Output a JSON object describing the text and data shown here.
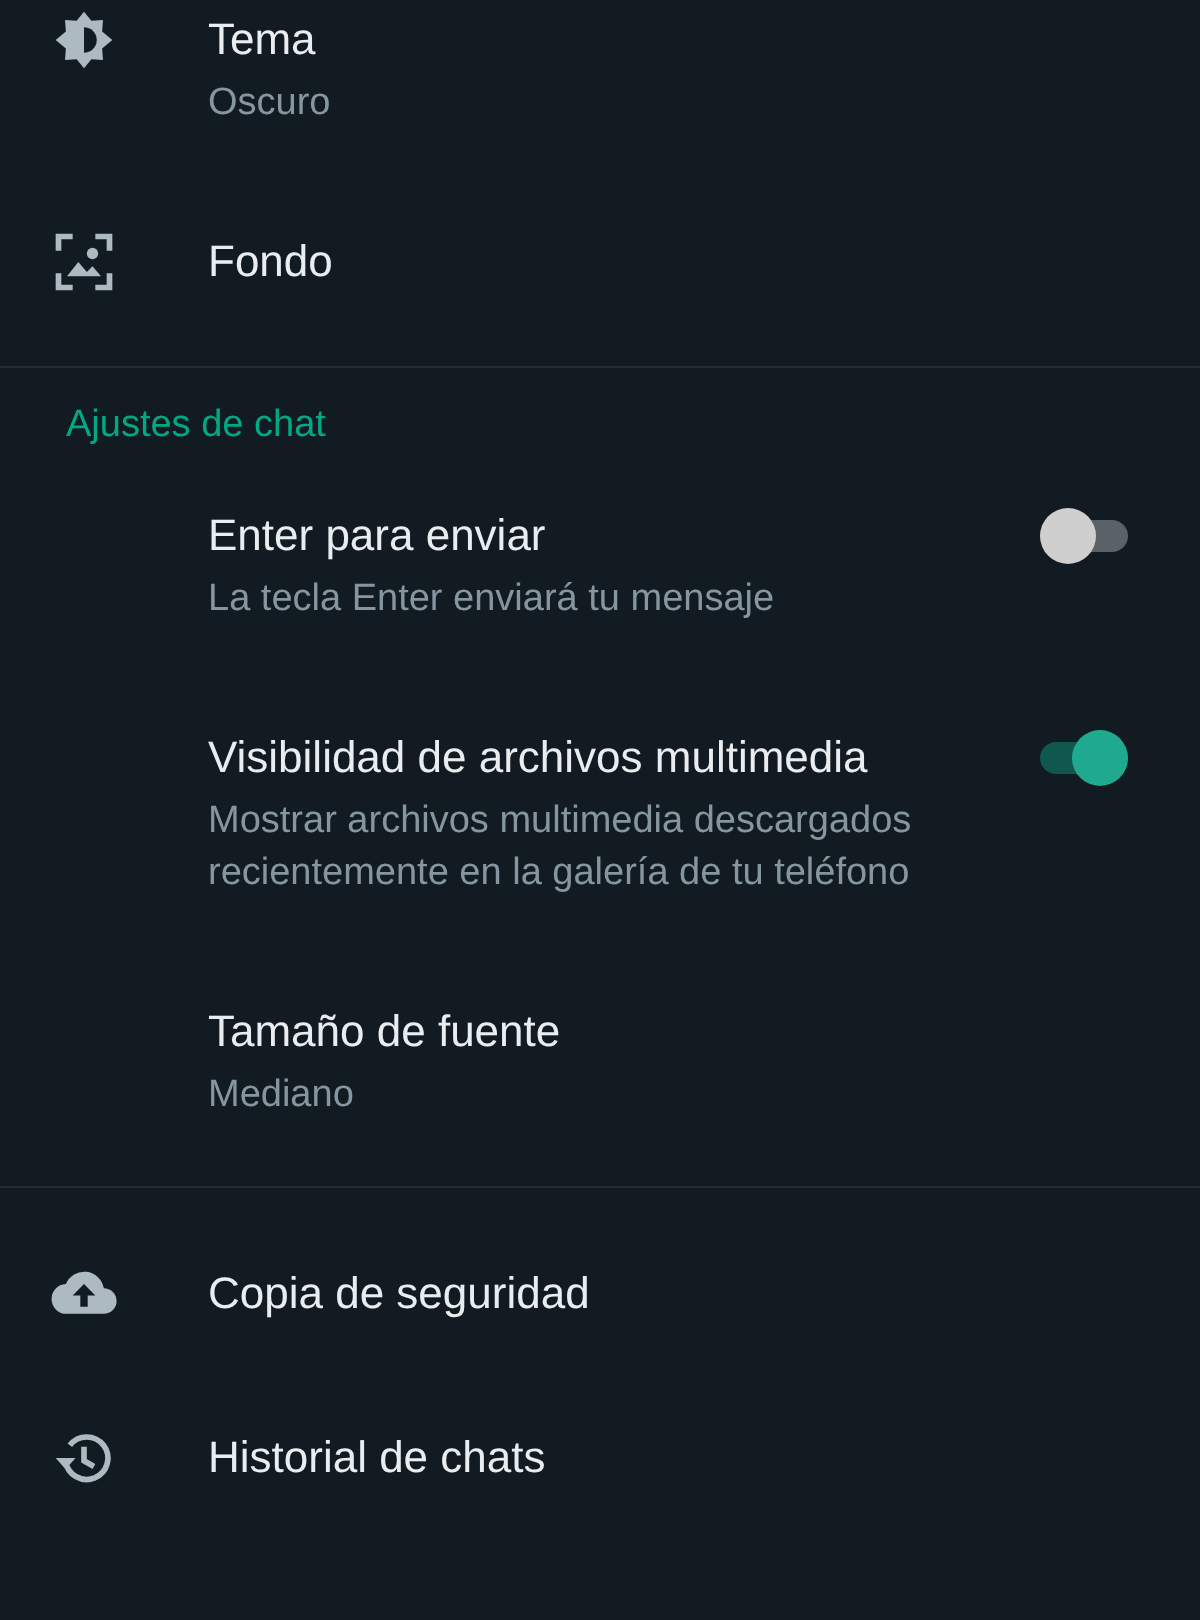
{
  "sections": [
    {
      "items": [
        {
          "kind": "icon",
          "title": "Tema",
          "subtitle": "Oscuro"
        },
        {
          "kind": "icon",
          "title": "Fondo"
        }
      ]
    },
    {
      "header": "Ajustes de chat",
      "items": [
        {
          "kind": "toggle",
          "title": "Enter para enviar",
          "subtitle": "La tecla Enter enviará tu mensaje",
          "on": false
        },
        {
          "kind": "toggle",
          "title": "Visibilidad de archivos multimedia",
          "subtitle": "Mostrar archivos multimedia descargados recientemente en la galería de tu teléfono",
          "on": true
        },
        {
          "kind": "text",
          "title": "Tamaño de fuente",
          "subtitle": "Mediano"
        }
      ]
    },
    {
      "items": [
        {
          "kind": "icon",
          "title": "Copia de seguridad"
        },
        {
          "kind": "icon",
          "title": "Historial de chats"
        }
      ]
    }
  ]
}
